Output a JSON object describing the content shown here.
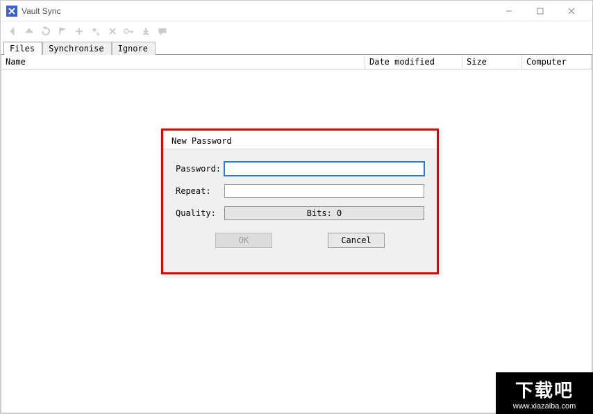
{
  "window": {
    "title": "Vault Sync"
  },
  "tabs": {
    "items": [
      {
        "label": "Files",
        "active": true
      },
      {
        "label": "Synchronise",
        "active": false
      },
      {
        "label": "Ignore",
        "active": false
      }
    ]
  },
  "columns": {
    "name": "Name",
    "date": "Date modified",
    "size": "Size",
    "computer": "Computer"
  },
  "dialog": {
    "title": "New Password",
    "password_label": "Password:",
    "repeat_label": "Repeat:",
    "quality_label": "Quality:",
    "quality_value": "Bits: 0",
    "ok_label": "OK",
    "cancel_label": "Cancel",
    "password_value": "",
    "repeat_value": ""
  },
  "watermark": {
    "text": "下载吧",
    "url": "www.xiazaiba.com"
  }
}
